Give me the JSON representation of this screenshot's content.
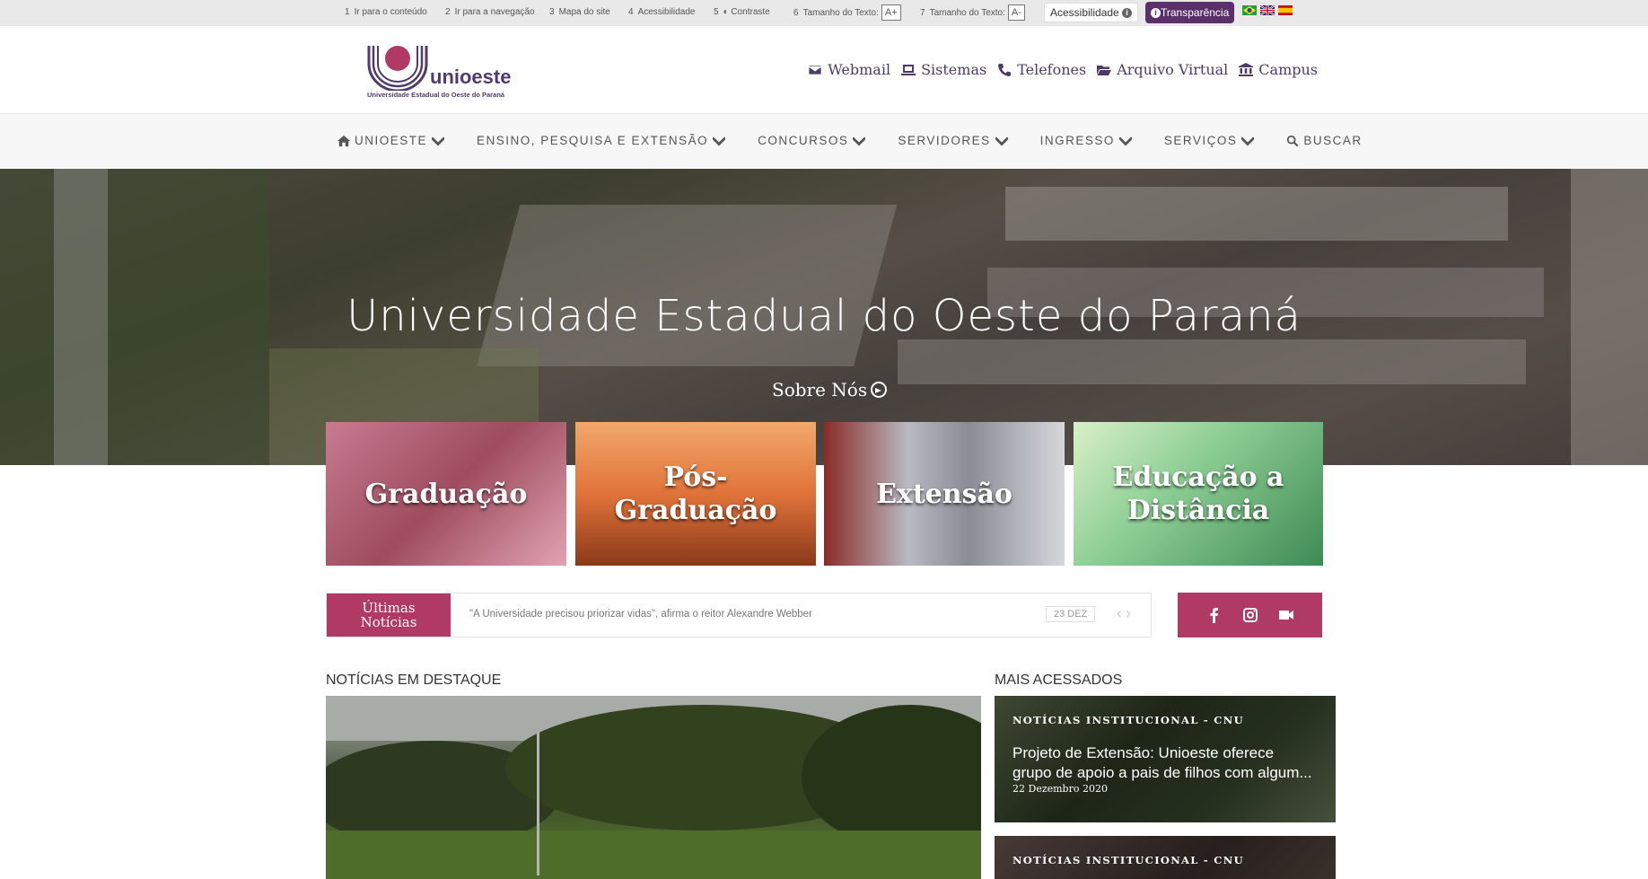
{
  "accessibility_bar": {
    "items": [
      {
        "num": "1",
        "label": "Ir para o conteúdo"
      },
      {
        "num": "2",
        "label": "Ir para a navegação"
      },
      {
        "num": "3",
        "label": "Mapa do site"
      },
      {
        "num": "4",
        "label": "Acessibilidade"
      },
      {
        "num": "5",
        "label": "Contraste"
      },
      {
        "num": "6",
        "label": "Tamanho do Texto:",
        "box": "A+"
      },
      {
        "num": "7",
        "label": "Tamanho do Texto:",
        "box": "A-"
      }
    ],
    "acessibilidade_button": "Acessibilidade",
    "transparencia_button": "Transparência"
  },
  "header": {
    "logo_word": "unioeste",
    "logo_sub": "Universidade Estadual do Oeste do Paraná",
    "links": [
      {
        "label": "Webmail",
        "icon": "envelope-icon"
      },
      {
        "label": "Sistemas",
        "icon": "laptop-icon"
      },
      {
        "label": "Telefones",
        "icon": "phone-icon"
      },
      {
        "label": "Arquivo Virtual",
        "icon": "folder-open-icon"
      },
      {
        "label": "Campus",
        "icon": "institution-icon"
      }
    ]
  },
  "nav": {
    "items": [
      {
        "label": "UNIOESTE"
      },
      {
        "label": "ENSINO, PESQUISA E EXTENSÃO"
      },
      {
        "label": "CONCURSOS"
      },
      {
        "label": "SERVIDORES"
      },
      {
        "label": "INGRESSO"
      },
      {
        "label": "SERVIÇOS"
      },
      {
        "label": "BUSCAR"
      }
    ]
  },
  "hero": {
    "title": "Universidade Estadual do Oeste do Paraná",
    "link": "Sobre Nós"
  },
  "cards": [
    {
      "label": "Graduação"
    },
    {
      "label_line1": "Pós-",
      "label_line2": "Graduação"
    },
    {
      "label": "Extensão"
    },
    {
      "label_line1": "Educação a",
      "label_line2": "Distância"
    }
  ],
  "ticker": {
    "label_line1": "Últimas",
    "label_line2": "Notícias",
    "text": "\"A Universidade precisou priorizar vidas\", afirma o reitor Alexandre Webber",
    "date": "23 DEZ"
  },
  "featured": {
    "title": "NOTÍCIAS EM DESTAQUE"
  },
  "most_accessed": {
    "title": "MAIS ACESSADOS",
    "items": [
      {
        "category": "NOTÍCIAS INSTITUCIONAL - CNU",
        "headline_line1": "Projeto de Extensão: Unioeste oferece",
        "headline_line2": "grupo de apoio a pais de filhos com algum...",
        "date": "22 Dezembro 2020"
      },
      {
        "category": "NOTÍCIAS INSTITUCIONAL - CNU"
      }
    ]
  },
  "colors": {
    "accent": "#b03a64",
    "brand_purple": "#4f3b6e",
    "transparencia_bg": "#5a2f6a"
  }
}
